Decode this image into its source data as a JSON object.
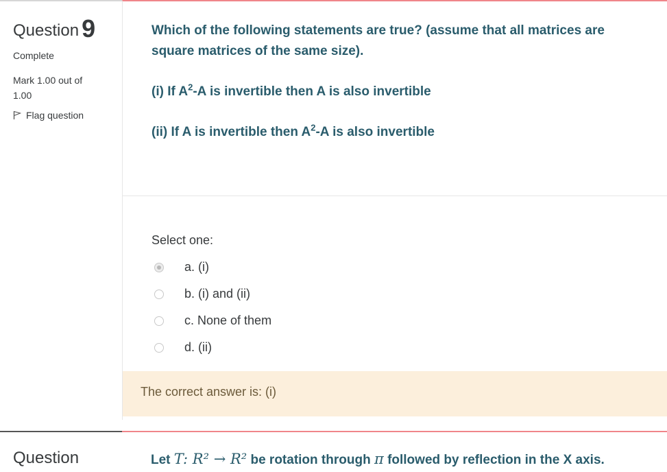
{
  "question9": {
    "info": {
      "title_word": "Question",
      "number": "9",
      "state": "Complete",
      "grade": "Mark 1.00 out of 1.00",
      "flag_label": "Flag question"
    },
    "text": {
      "p1": "Which of the following statements are true? (assume that all matrices are square matrices of the same size).",
      "p2_pre": "(i) If A",
      "p2_sup": "2",
      "p2_post": "-A is invertible then A is also invertible",
      "p3_pre": "(ii) If A is invertible then A",
      "p3_sup": "2",
      "p3_post": "-A is also invertible"
    },
    "prompt": "Select one:",
    "options": [
      {
        "label": "a. (i)",
        "checked": true
      },
      {
        "label": "b. (i) and (ii)",
        "checked": false
      },
      {
        "label": "c. None of them",
        "checked": false
      },
      {
        "label": "d. (ii)",
        "checked": false
      }
    ],
    "feedback": "The correct answer is: (i)"
  },
  "question10": {
    "info": {
      "title_word": "Question"
    },
    "text": {
      "lead": "Let",
      "math": "T: R² → R²",
      "mid": "be rotation through",
      "pi": "π",
      "tail": "followed by reflection in the X axis."
    }
  },
  "colors": {
    "question_text": "#2a5c6c",
    "accent_border": "#f0858a",
    "feedback_bg": "#fcefdc"
  }
}
